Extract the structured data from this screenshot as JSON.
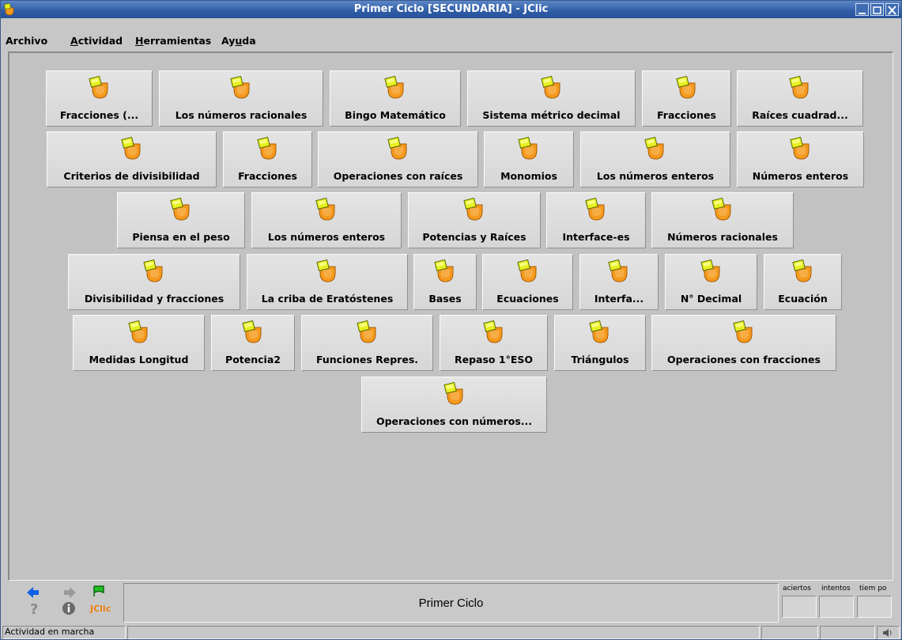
{
  "window": {
    "title": "Primer Ciclo [SECUNDARIA] - JClic"
  },
  "menu": {
    "archivo": "Archivo",
    "actividad_u": "A",
    "actividad_rest": "ctividad",
    "herramientas_u": "H",
    "herramientas_rest": "erramientas",
    "ayuda_pre": "Ay",
    "ayuda_u": "u",
    "ayuda_rest": "da"
  },
  "activities": [
    {
      "label": "Fracciones (..."
    },
    {
      "label": "Los números racionales"
    },
    {
      "label": "Bingo Matemático"
    },
    {
      "label": "Sistema métrico decimal"
    },
    {
      "label": "Fracciones"
    },
    {
      "label": "Raíces cuadrad..."
    },
    {
      "label": "Criterios de divisibilidad"
    },
    {
      "label": "Fracciones"
    },
    {
      "label": "Operaciones con raíces"
    },
    {
      "label": "Monomios"
    },
    {
      "label": "Los números enteros"
    },
    {
      "label": "Números enteros"
    },
    {
      "label": "Piensa en el peso"
    },
    {
      "label": "Los números enteros"
    },
    {
      "label": "Potencias y Raíces"
    },
    {
      "label": "Interface-es"
    },
    {
      "label": "Números racionales"
    },
    {
      "label": "Divisibilidad y fracciones"
    },
    {
      "label": "La criba de Eratóstenes"
    },
    {
      "label": "Bases"
    },
    {
      "label": "Ecuaciones"
    },
    {
      "label": "Interfa..."
    },
    {
      "label": "N° Decimal"
    },
    {
      "label": "Ecuación"
    },
    {
      "label": "Medidas Longitud"
    },
    {
      "label": "Potencia2"
    },
    {
      "label": "Funciones Repres."
    },
    {
      "label": "Repaso 1°ESO"
    },
    {
      "label": "Triángulos"
    },
    {
      "label": "Operaciones con fracciones"
    },
    {
      "label": "Operaciones con números..."
    }
  ],
  "bottom": {
    "panel_text": "Primer Ciclo",
    "counters": {
      "aciertos": "aciertos",
      "intentos": "intentos",
      "tiempo": "tiem po"
    },
    "jclic_logo": "JClic"
  },
  "status": {
    "text": "Actividad en marcha"
  },
  "colors": {
    "titlebar": "#2f5da6",
    "background": "#c7c7c7",
    "button": "#dcdcdc",
    "icon_orange": "#f59a1e",
    "icon_yellow": "#e8f020"
  }
}
